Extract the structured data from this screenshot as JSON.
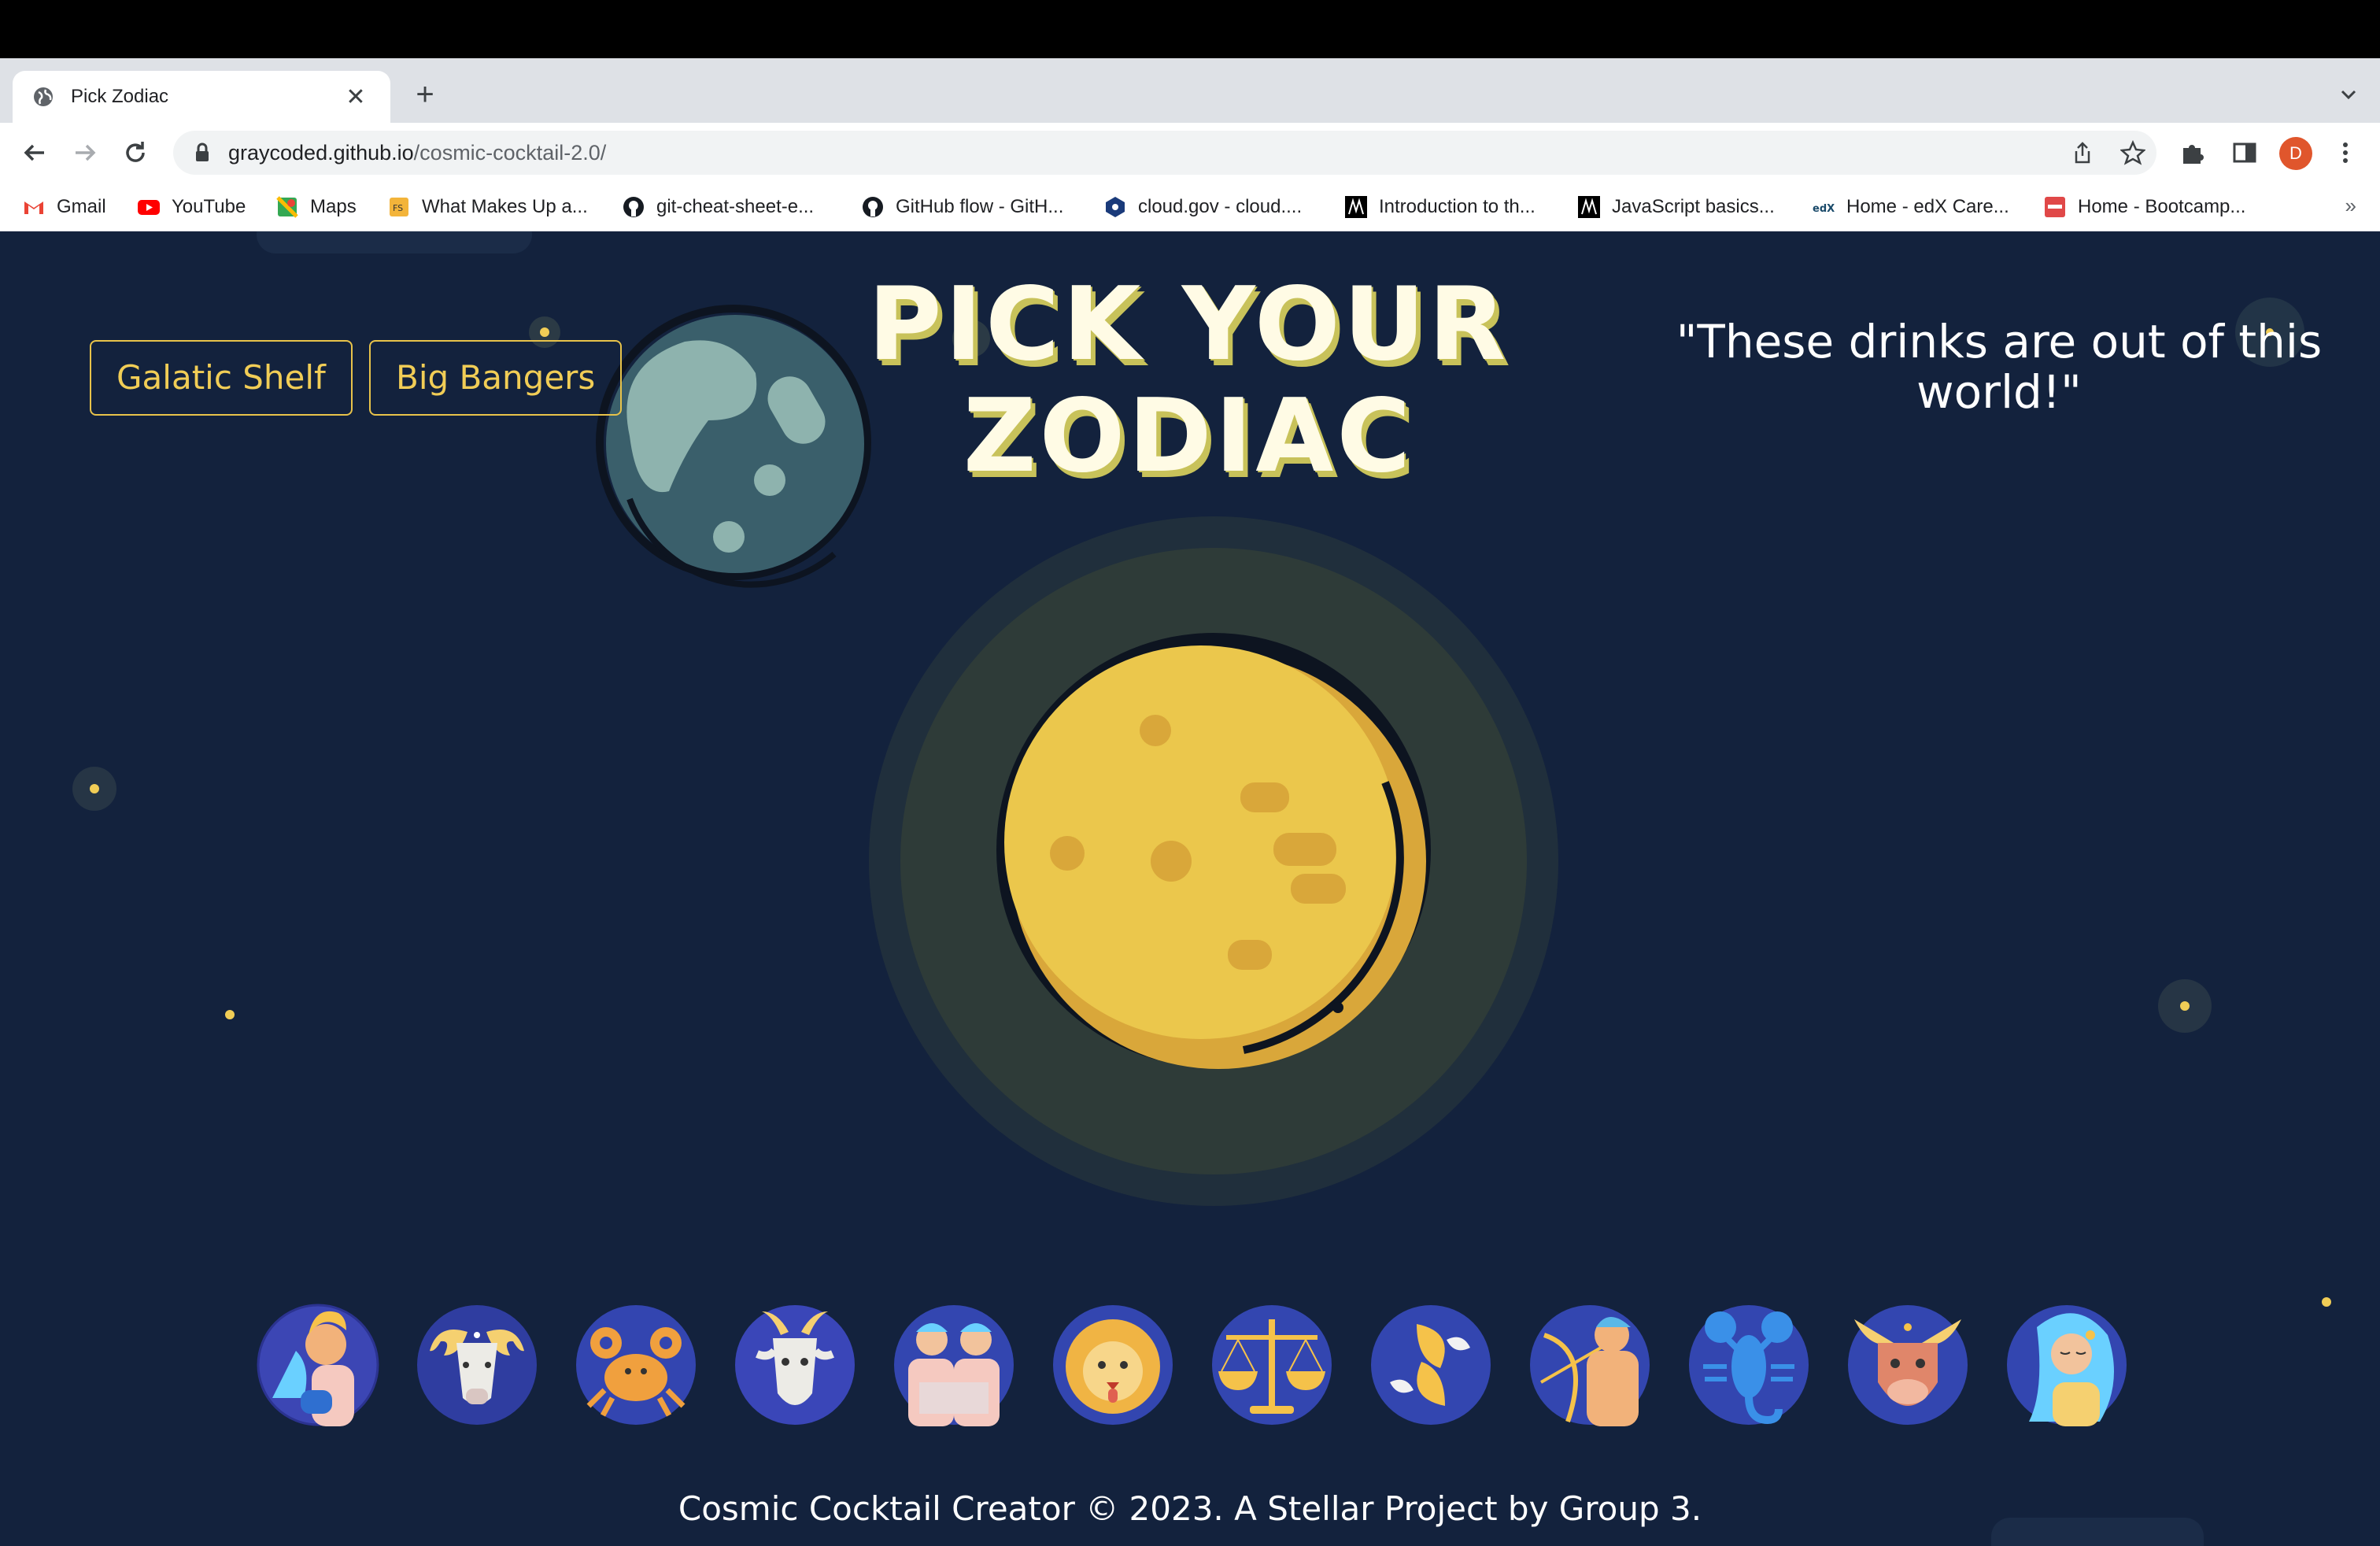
{
  "browser": {
    "tab_title": "Pick Zodiac",
    "new_tab_symbol": "+",
    "close_symbol": "✕",
    "url_host": "graycoded.github.io",
    "url_path": "/cosmic-cocktail-2.0/",
    "avatar_letter": "D",
    "bookmarks": [
      {
        "label": "Gmail",
        "icon": "gmail-icon"
      },
      {
        "label": "YouTube",
        "icon": "youtube-icon"
      },
      {
        "label": "Maps",
        "icon": "maps-icon"
      },
      {
        "label": "What Makes Up a...",
        "icon": "fs-icon"
      },
      {
        "label": "git-cheat-sheet-e...",
        "icon": "github-icon"
      },
      {
        "label": "GitHub flow - GitH...",
        "icon": "github-icon"
      },
      {
        "label": "cloud.gov - cloud....",
        "icon": "cloudgov-icon"
      },
      {
        "label": "Introduction to th...",
        "icon": "m-icon"
      },
      {
        "label": "JavaScript basics...",
        "icon": "m-icon"
      },
      {
        "label": "Home - edX Care...",
        "icon": "edx-icon"
      },
      {
        "label": "Home - Bootcamp...",
        "icon": "bootcamp-icon"
      }
    ],
    "more_bookmarks": "»"
  },
  "page": {
    "nav": {
      "galatic_shelf": "Galatic Shelf",
      "big_bangers": "Big Bangers"
    },
    "heading": "PICK YOUR ZODIAC",
    "tagline": "\"These drinks are out of this world!\"",
    "footer": "Cosmic Cocktail Creator © 2023. A Stellar Project by Group 3.",
    "zodiac_signs": [
      "aquarius-icon",
      "aries-icon",
      "cancer-icon",
      "capricorn-icon",
      "gemini-icon",
      "leo-icon",
      "libra-icon",
      "pisces-icon",
      "sagittarius-icon",
      "scorpio-icon",
      "taurus-icon",
      "virgo-icon"
    ]
  },
  "colors": {
    "background": "#13223d",
    "accent_yellow": "#f1cd56",
    "moon": "#e8c44a",
    "planet": "#3a5f6b"
  }
}
